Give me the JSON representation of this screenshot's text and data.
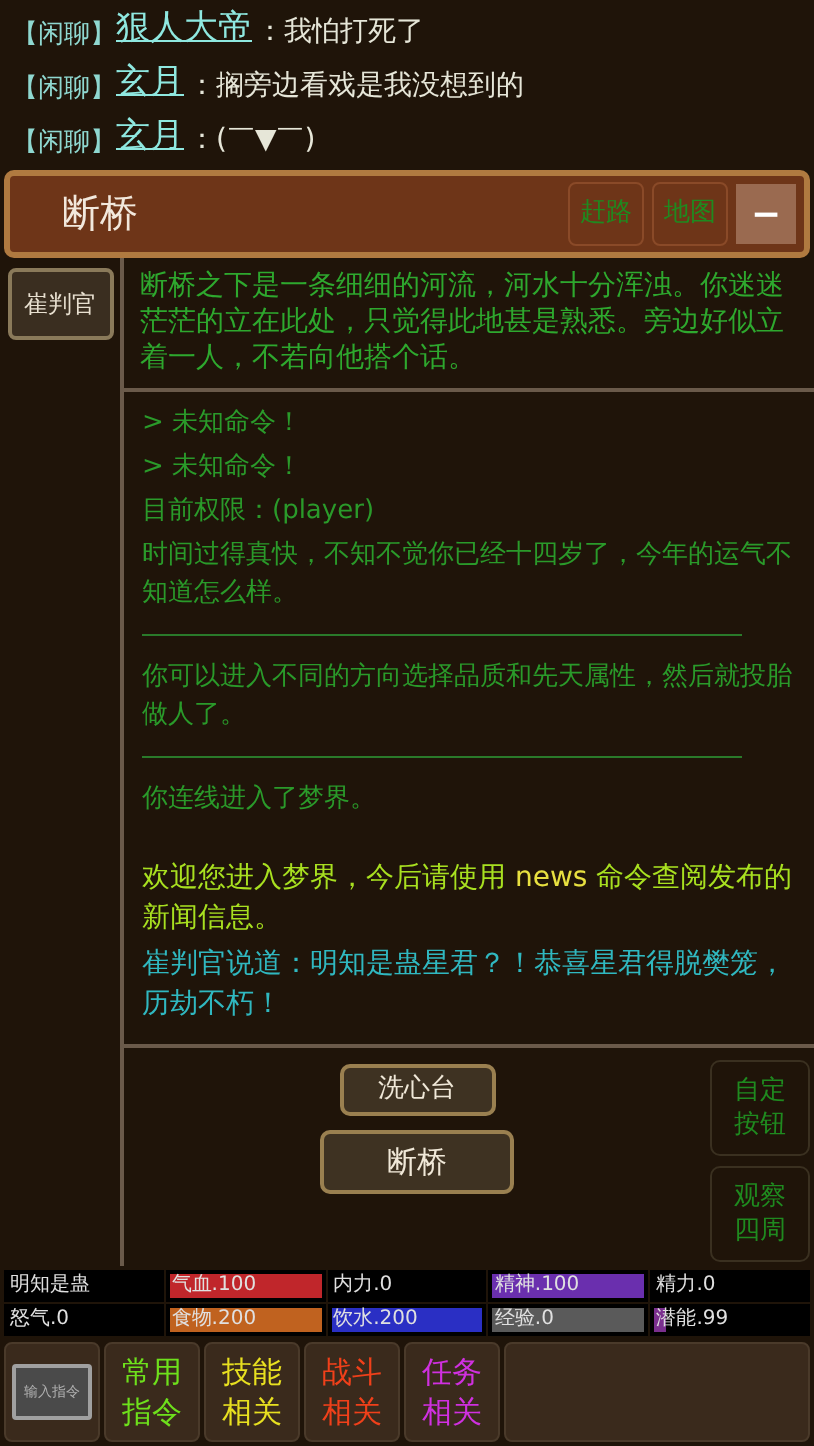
{
  "chat": [
    {
      "channel": "【闲聊】",
      "name": "狠人大帝",
      "message": "：我怕打死了"
    },
    {
      "channel": "【闲聊】",
      "name": "玄月",
      "message": "：搁旁边看戏是我没想到的"
    },
    {
      "channel": "【闲聊】",
      "name": "玄月",
      "message": "：(￣▼￣)"
    }
  ],
  "location": {
    "title": "断桥",
    "buttons": [
      "赶路",
      "地图"
    ],
    "collapse": "−"
  },
  "npcs": [
    "崔判官"
  ],
  "description": "断桥之下是一条细细的河流，河水十分浑浊。你迷迷茫茫的立在此处，只觉得此地甚是熟悉。旁边好似立着一人，不若向他搭个话。",
  "log": [
    {
      "kind": "echo",
      "text": "> 未知命令！"
    },
    {
      "kind": "echo",
      "text": "> 未知命令！"
    },
    {
      "kind": "echo",
      "text": "目前权限：(player)"
    },
    {
      "kind": "echo",
      "text": "时间过得真快，不知不觉你已经十四岁了，今年的运气不知道怎么样。"
    },
    {
      "kind": "rule"
    },
    {
      "kind": "echo",
      "text": "你可以进入不同的方向选择品质和先天属性，然后就投胎做人了。"
    },
    {
      "kind": "rule"
    },
    {
      "kind": "echo",
      "text": "你连线进入了梦界。"
    },
    {
      "kind": "gap"
    },
    {
      "kind": "notice",
      "parts": [
        {
          "kind": "plain",
          "text": "欢迎您进入梦界，今后请使用 "
        },
        {
          "kind": "command",
          "text": "news"
        },
        {
          "kind": "plain",
          "text": " 命令查阅发布的新闻信息。"
        }
      ]
    },
    {
      "kind": "say",
      "text": "崔判官说道：明知是蛊星君？！恭喜星君得脱樊笼，历劫不朽！"
    }
  ],
  "exits": [
    "洗心台",
    "断桥"
  ],
  "side_buttons": [
    "自定按钮",
    "观察四周"
  ],
  "stats": [
    {
      "label": "明知是蛊"
    },
    {
      "label": "气血.100",
      "color": "#c0262b",
      "level": 1
    },
    {
      "label": "内力.0"
    },
    {
      "label": "精神.100",
      "color": "#6a2fae",
      "level": 1
    },
    {
      "label": "精力.0"
    },
    {
      "label": "怒气.0"
    },
    {
      "label": "食物.200",
      "color": "#c0621f",
      "level": 1
    },
    {
      "label": "饮水.200",
      "color": "#2a2fc4",
      "level": 1
    },
    {
      "label": "经验.0",
      "color": "#5a5a5a",
      "level": 1
    },
    {
      "label": "潜能.99",
      "color": "#7a2f8e",
      "level": 0.08
    }
  ],
  "toolbar": [
    {
      "kind": "input",
      "label": "输入指令"
    },
    {
      "kind": "command",
      "label": "常用指令",
      "color": "#6ee01c"
    },
    {
      "kind": "command",
      "label": "技能相关",
      "color": "#e8e020"
    },
    {
      "kind": "command",
      "label": "战斗相关",
      "color": "#f0401a"
    },
    {
      "kind": "command",
      "label": "任务相关",
      "color": "#d030e0"
    }
  ]
}
